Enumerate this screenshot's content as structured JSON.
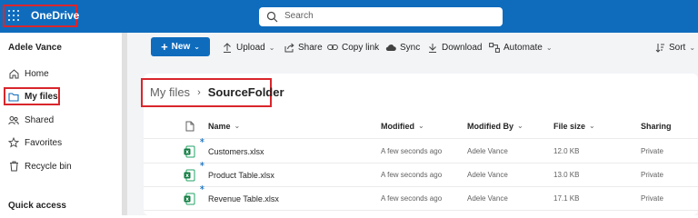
{
  "app": {
    "name": "OneDrive",
    "brand_color": "#0f6cbd",
    "highlight_color": "#d9262c"
  },
  "search": {
    "placeholder": "Search"
  },
  "sidebar": {
    "user": "Adele Vance",
    "items": [
      {
        "label": "Home",
        "icon": "home-icon"
      },
      {
        "label": "My files",
        "icon": "folder-icon",
        "selected": true
      },
      {
        "label": "Shared",
        "icon": "shared-icon"
      },
      {
        "label": "Favorites",
        "icon": "star-icon"
      },
      {
        "label": "Recycle bin",
        "icon": "trash-icon"
      }
    ],
    "quick_access": "Quick access"
  },
  "toolbar": {
    "new_label": "New",
    "upload": "Upload",
    "share": "Share",
    "copy_link": "Copy link",
    "sync": "Sync",
    "download": "Download",
    "automate": "Automate",
    "sort": "Sort"
  },
  "breadcrumb": {
    "root": "My files",
    "current": "SourceFolder"
  },
  "table": {
    "columns": {
      "name": "Name",
      "modified": "Modified",
      "modified_by": "Modified By",
      "file_size": "File size",
      "sharing": "Sharing"
    },
    "rows": [
      {
        "name": "Customers.xlsx",
        "modified": "A few seconds ago",
        "modified_by": "Adele Vance",
        "size": "12.0 KB",
        "sharing": "Private"
      },
      {
        "name": "Product Table.xlsx",
        "modified": "A few seconds ago",
        "modified_by": "Adele Vance",
        "size": "13.0 KB",
        "sharing": "Private"
      },
      {
        "name": "Revenue Table.xlsx",
        "modified": "A few seconds ago",
        "modified_by": "Adele Vance",
        "size": "17.1 KB",
        "sharing": "Private"
      }
    ]
  }
}
